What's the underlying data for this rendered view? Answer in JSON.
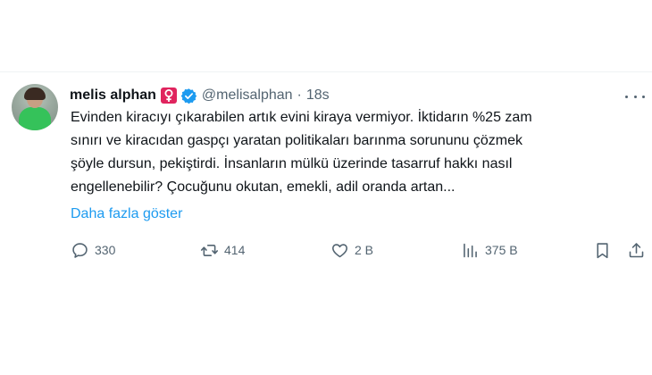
{
  "tweet": {
    "author": {
      "name": "melis alphan",
      "handle": "@melisalphan",
      "badges": [
        "female-sign-icon",
        "verified-badge-icon"
      ]
    },
    "separator": "·",
    "time": "18s",
    "text_lines": [
      "Evinden kiracıyı çıkarabilen artık evini kiraya vermiyor. İktidarın %25 zam",
      "sınırı ve kiracıdan gaspçı yaratan politikaları barınma sorununu çözmek",
      "şöyle dursun, pekiştirdi. İnsanların mülkü üzerinde tasarruf hakkı nasıl",
      "engellenebilir? Çocuğunu okutan, emekli, adil oranda artan..."
    ],
    "show_more": "Daha fazla göster",
    "actions": {
      "replies": "330",
      "retweets": "414",
      "likes": "2 B",
      "views": "375 B"
    }
  },
  "colors": {
    "text": "#0f1419",
    "secondary": "#536471",
    "link": "#1d9bf0",
    "verified": "#1d9bf0",
    "female_badge": "#e0245e"
  }
}
